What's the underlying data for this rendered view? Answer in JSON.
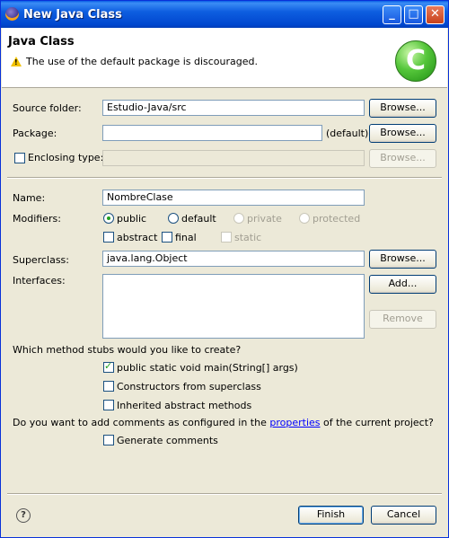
{
  "window": {
    "title": "New Java Class"
  },
  "header": {
    "title": "Java Class",
    "message": "The use of the default package is discouraged.",
    "warning_icon": "warning-icon",
    "class_icon": "new-class-icon",
    "class_icon_glyph": "C"
  },
  "form": {
    "source_folder_label": "Source folder:",
    "source_folder_value": "Estudio-Java/src",
    "package_label": "Package:",
    "package_value": "",
    "package_default": "(default)",
    "enclosing_type_label": "Enclosing type:",
    "enclosing_type_value": "",
    "browse_label": "Browse...",
    "name_label": "Name:",
    "name_value": "NombreClase",
    "modifiers_label": "Modifiers:",
    "modifiers": {
      "public": "public",
      "default": "default",
      "private": "private",
      "protected": "protected",
      "abstract": "abstract",
      "final": "final",
      "static": "static"
    },
    "superclass_label": "Superclass:",
    "superclass_value": "java.lang.Object",
    "interfaces_label": "Interfaces:",
    "add_label": "Add...",
    "remove_label": "Remove"
  },
  "stubs": {
    "question": "Which method stubs would you like to create?",
    "main": "public static void main(String[] args)",
    "constructors": "Constructors from superclass",
    "inherited": "Inherited abstract methods"
  },
  "comments": {
    "question_prefix": "Do you want to add comments as configured in the ",
    "question_link": "properties",
    "question_suffix": " of the current project?",
    "generate": "Generate comments"
  },
  "footer": {
    "help_glyph": "?",
    "finish": "Finish",
    "cancel": "Cancel"
  },
  "titlebar_buttons": {
    "minimize": "_",
    "maximize": "□",
    "close": "✕"
  }
}
